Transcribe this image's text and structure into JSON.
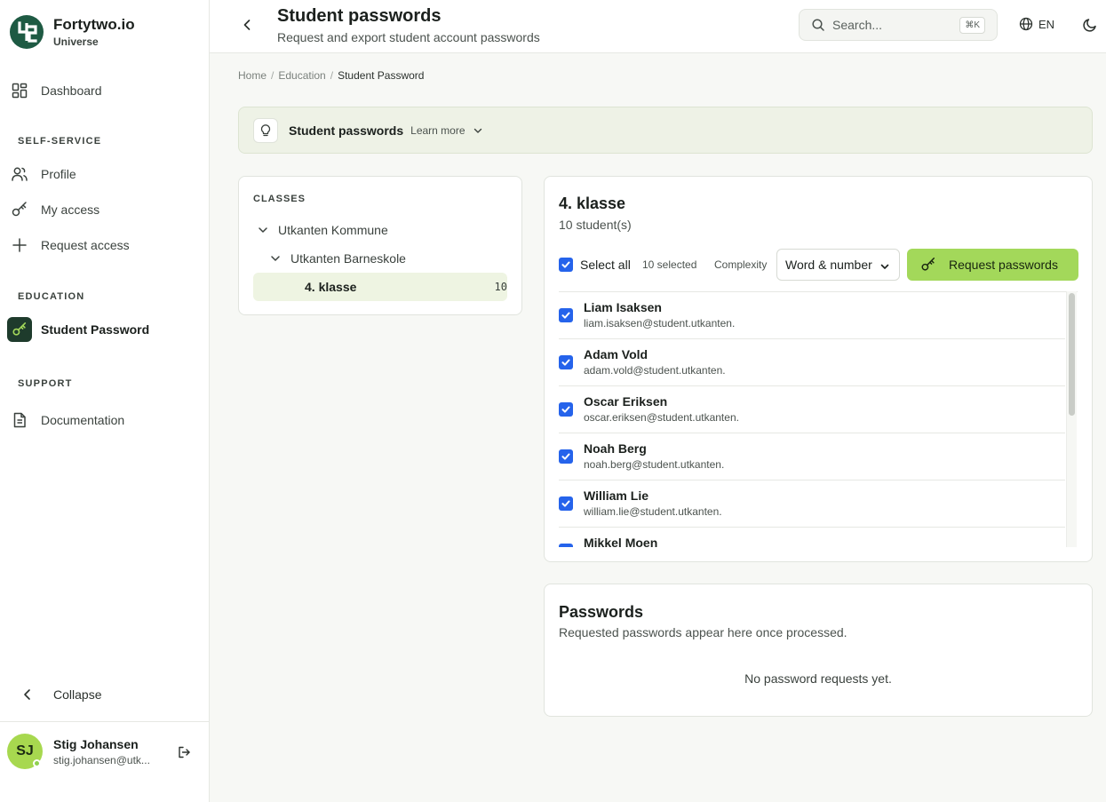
{
  "brand": {
    "name": "Fortytwo.io",
    "subtitle": "Universe",
    "brand_color": "#1e5a43"
  },
  "sidebar": {
    "dashboard": "Dashboard",
    "section_self_service": "SELF-SERVICE",
    "profile": "Profile",
    "my_access": "My access",
    "request_access": "Request access",
    "section_education": "EDUCATION",
    "student_password": "Student Password",
    "section_support": "SUPPORT",
    "documentation": "Documentation",
    "collapse": "Collapse"
  },
  "user": {
    "initials": "SJ",
    "name": "Stig Johansen",
    "email": "stig.johansen@utk..."
  },
  "header": {
    "title": "Student passwords",
    "subtitle": "Request and export student account passwords",
    "search_placeholder": "Search...",
    "search_shortcut": "⌘K",
    "language": "EN"
  },
  "breadcrumb": {
    "home": "Home",
    "education": "Education",
    "current": "Student Password"
  },
  "banner": {
    "title": "Student passwords",
    "learn_more": "Learn more"
  },
  "classes": {
    "heading": "CLASSES",
    "municipality": "Utkanten Kommune",
    "school": "Utkanten Barneskole",
    "selected_class": "4. klasse",
    "selected_count": "10"
  },
  "class_panel": {
    "title": "4. klasse",
    "count": "10 student(s)",
    "select_all": "Select all",
    "selected": "10 selected",
    "complexity_label": "Complexity",
    "complexity_value": "Word & number",
    "request_button": "Request passwords",
    "accent": "#a3d85a",
    "checkbox_color": "#2563eb"
  },
  "students": [
    {
      "name": "Liam Isaksen",
      "email": "liam.isaksen@student.utkanten."
    },
    {
      "name": "Adam Vold",
      "email": "adam.vold@student.utkanten."
    },
    {
      "name": "Oscar Eriksen",
      "email": "oscar.eriksen@student.utkanten."
    },
    {
      "name": "Noah Berg",
      "email": "noah.berg@student.utkanten."
    },
    {
      "name": "William Lie",
      "email": "william.lie@student.utkanten."
    },
    {
      "name": "Mikkel Moen",
      "email": ""
    }
  ],
  "passwords": {
    "title": "Passwords",
    "subtitle": "Requested passwords appear here once processed.",
    "empty": "No password requests yet."
  }
}
